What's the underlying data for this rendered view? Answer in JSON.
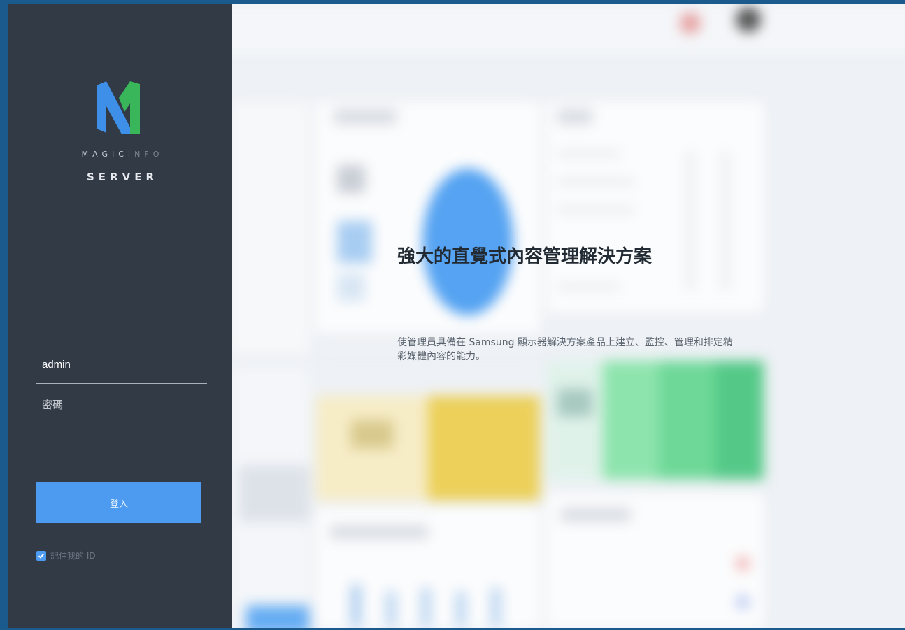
{
  "brand": {
    "logo_line1_bright": "MAGIC",
    "logo_line1_dim": "INFO",
    "logo_line2": "SERVER",
    "colors": {
      "logo_blue": "#3d8fe8",
      "logo_green": "#39b55a",
      "panel_bg": "#323a46",
      "accent": "#4c9bf0"
    }
  },
  "login": {
    "username_value": "admin",
    "password_placeholder": "密碼",
    "submit_label": "登入",
    "remember_label": "記住我的 ID",
    "remember_checked": true
  },
  "hero": {
    "title": "強大的直覺式內容管理解決方案",
    "description": "使管理員具備在 Samsung 顯示器解決方案產品上建立、監控、管理和排定精彩媒體內容的能力。"
  },
  "icons": {
    "logo": "magicinfo-logo-icon",
    "checkbox": "checkmark-icon"
  }
}
